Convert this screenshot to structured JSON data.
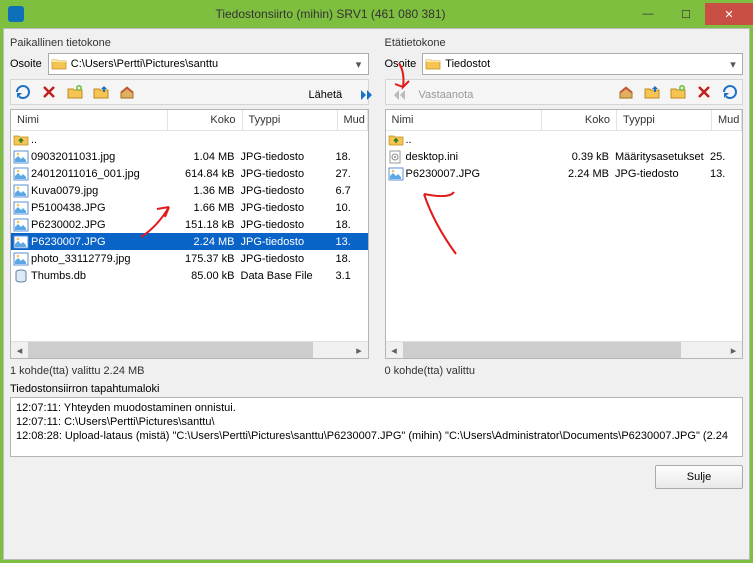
{
  "window": {
    "title": "Tiedostonsiirto (mihin) SRV1 (461 080 381)"
  },
  "left": {
    "title": "Paikallinen tietokone",
    "addr_label": "Osoite",
    "path": "C:\\Users\\Pertti\\Pictures\\santtu",
    "headers": {
      "name": "Nimi",
      "size": "Koko",
      "type": "Tyyppi",
      "mod": "Mud"
    },
    "files": [
      {
        "icon": "folder-up",
        "name": "..",
        "size": "",
        "type": "",
        "mod": ""
      },
      {
        "icon": "image",
        "name": "09032011031.jpg",
        "size": "1.04 MB",
        "type": "JPG-tiedosto",
        "mod": "18."
      },
      {
        "icon": "image",
        "name": "24012011016_001.jpg",
        "size": "614.84 kB",
        "type": "JPG-tiedosto",
        "mod": "27."
      },
      {
        "icon": "image",
        "name": "Kuva0079.jpg",
        "size": "1.36 MB",
        "type": "JPG-tiedosto",
        "mod": "6.7"
      },
      {
        "icon": "image",
        "name": "P5100438.JPG",
        "size": "1.66 MB",
        "type": "JPG-tiedosto",
        "mod": "10."
      },
      {
        "icon": "image",
        "name": "P6230002.JPG",
        "size": "151.18 kB",
        "type": "JPG-tiedosto",
        "mod": "18."
      },
      {
        "icon": "image",
        "name": "P6230007.JPG",
        "size": "2.24 MB",
        "type": "JPG-tiedosto",
        "mod": "13.",
        "selected": true
      },
      {
        "icon": "image",
        "name": "photo_33112779.jpg",
        "size": "175.37 kB",
        "type": "JPG-tiedosto",
        "mod": "18."
      },
      {
        "icon": "db",
        "name": "Thumbs.db",
        "size": "85.00 kB",
        "type": "Data Base File",
        "mod": "3.1"
      }
    ],
    "status": "1 kohde(tta) valittu  2.24 MB"
  },
  "right": {
    "title": "Etätietokone",
    "addr_label": "Osoite",
    "path": "Tiedostot",
    "headers": {
      "name": "Nimi",
      "size": "Koko",
      "type": "Tyyppi",
      "mod": "Mud"
    },
    "files": [
      {
        "icon": "folder-up",
        "name": "..",
        "size": "",
        "type": "",
        "mod": ""
      },
      {
        "icon": "ini",
        "name": "desktop.ini",
        "size": "0.39 kB",
        "type": "Määritysasetukset",
        "mod": "25."
      },
      {
        "icon": "image",
        "name": "P6230007.JPG",
        "size": "2.24 MB",
        "type": "JPG-tiedosto",
        "mod": "13."
      }
    ],
    "status": "0 kohde(tta) valittu"
  },
  "transfer": {
    "send": "Lähetä",
    "receive": "Vastaanota"
  },
  "log": {
    "label": "Tiedostonsiirron tapahtumaloki",
    "lines": [
      "12:07:11: Yhteyden muodostaminen onnistui.",
      "12:07:11: C:\\Users\\Pertti\\Pictures\\santtu\\",
      "12:08:28: Upload-lataus (mistä) \"C:\\Users\\Pertti\\Pictures\\santtu\\P6230007.JPG\" (mihin) \"C:\\Users\\Administrator\\Documents\\P6230007.JPG\" (2.24"
    ]
  },
  "close_btn": "Sulje"
}
